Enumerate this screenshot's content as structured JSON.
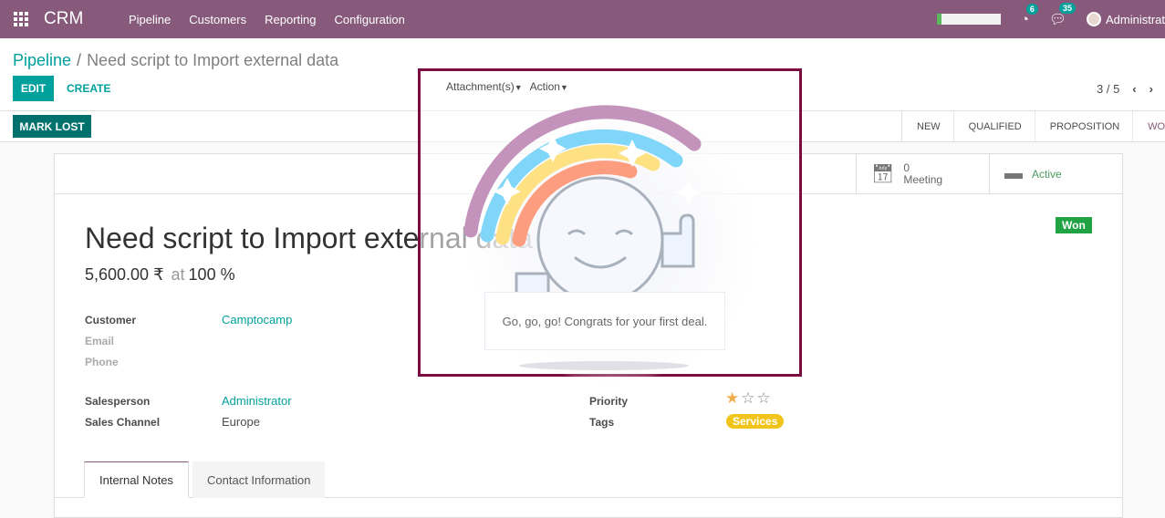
{
  "topbar": {
    "app_name": "CRM",
    "menu": [
      "Pipeline",
      "Customers",
      "Reporting",
      "Configuration"
    ],
    "progress_fraction": 0.08,
    "activity_count": "6",
    "messages_count": "35",
    "user_name": "Administrat"
  },
  "control_panel": {
    "breadcrumb_parent": "Pipeline",
    "breadcrumb_separator": "/",
    "breadcrumb_current": "Need script to Import external data",
    "edit_label": "EDIT",
    "create_label": "CREATE",
    "attachments_label": "Attachment(s)",
    "action_label": "Action",
    "pager": "3 / 5",
    "prev_icon": "‹",
    "next_icon": "›"
  },
  "statusbar": {
    "mark_lost_label": "MARK LOST",
    "stages": [
      "NEW",
      "QUALIFIED",
      "PROPOSITION",
      "WON"
    ]
  },
  "button_box": {
    "meeting_count": "0",
    "meeting_label": "Meeting",
    "active_label": "Active"
  },
  "record": {
    "won_badge": "Won",
    "title": "Need script to Import external data",
    "amount": "5,600.00 ₹",
    "at_label": "at",
    "probability": "100 %",
    "fields": {
      "customer_label": "Customer",
      "customer_value": "Camptocamp",
      "email_label": "Email",
      "phone_label": "Phone",
      "salesperson_label": "Salesperson",
      "salesperson_value": "Administrator",
      "sales_channel_label": "Sales Channel",
      "sales_channel_value": "Europe",
      "priority_label": "Priority",
      "priority_stars": 1,
      "priority_max": 3,
      "tags_label": "Tags",
      "tag_value": "Services"
    },
    "tabs": [
      "Internal Notes",
      "Contact Information"
    ]
  },
  "rainbow_man": {
    "message": "Go, go, go! Congrats for your first deal."
  },
  "colors": {
    "brand": "#875a7b",
    "accent": "#00a09d",
    "won_green": "#21a345",
    "tag_yellow": "#f0c419",
    "highlight_border": "#7a0c3f"
  }
}
